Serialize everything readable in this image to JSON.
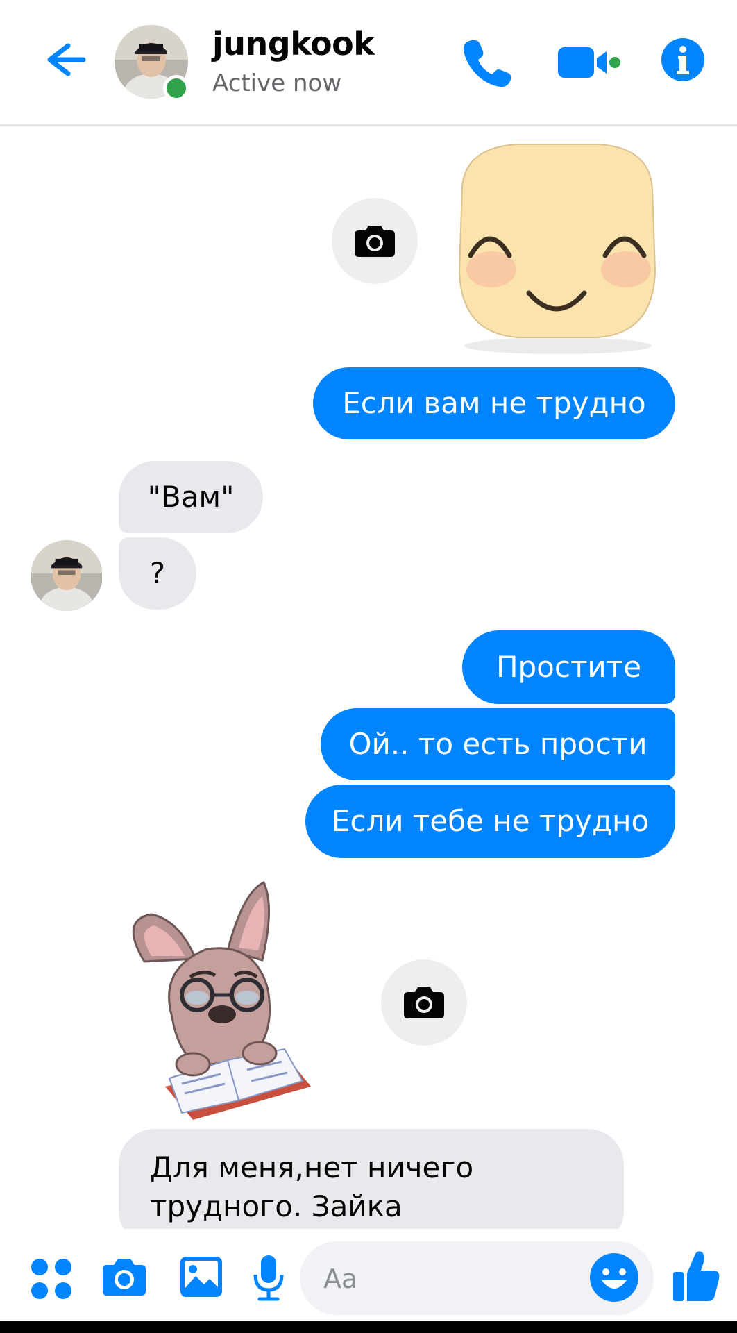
{
  "header": {
    "contact_name": "jungkook",
    "status": "Active now"
  },
  "messages": [
    {
      "type": "sticker",
      "direction": "outgoing",
      "icon": "smiling-face-sticker"
    },
    {
      "type": "text",
      "direction": "outgoing",
      "text": "Если вам не трудно"
    },
    {
      "type": "text",
      "direction": "incoming",
      "text": "\"Вам\""
    },
    {
      "type": "text",
      "direction": "incoming",
      "text": "?"
    },
    {
      "type": "text",
      "direction": "outgoing",
      "text": "Простите"
    },
    {
      "type": "text",
      "direction": "outgoing",
      "text": "Ой.. то есть прости"
    },
    {
      "type": "text",
      "direction": "outgoing",
      "text": "Если тебе не трудно"
    },
    {
      "type": "sticker",
      "direction": "incoming",
      "icon": "reading-dog-sticker"
    },
    {
      "type": "text",
      "direction": "incoming",
      "text_line1": "Для меня,нет ничего",
      "text_line2": "трудного. Зайка"
    }
  ],
  "composer": {
    "placeholder": "Aa",
    "icons": [
      "apps-icon",
      "camera-icon",
      "gallery-icon",
      "microphone-icon",
      "emoji-icon",
      "like-icon"
    ]
  },
  "colors": {
    "accent": "#0084ff",
    "incoming_bubble": "#e9e8ec",
    "online": "#31a24c"
  }
}
